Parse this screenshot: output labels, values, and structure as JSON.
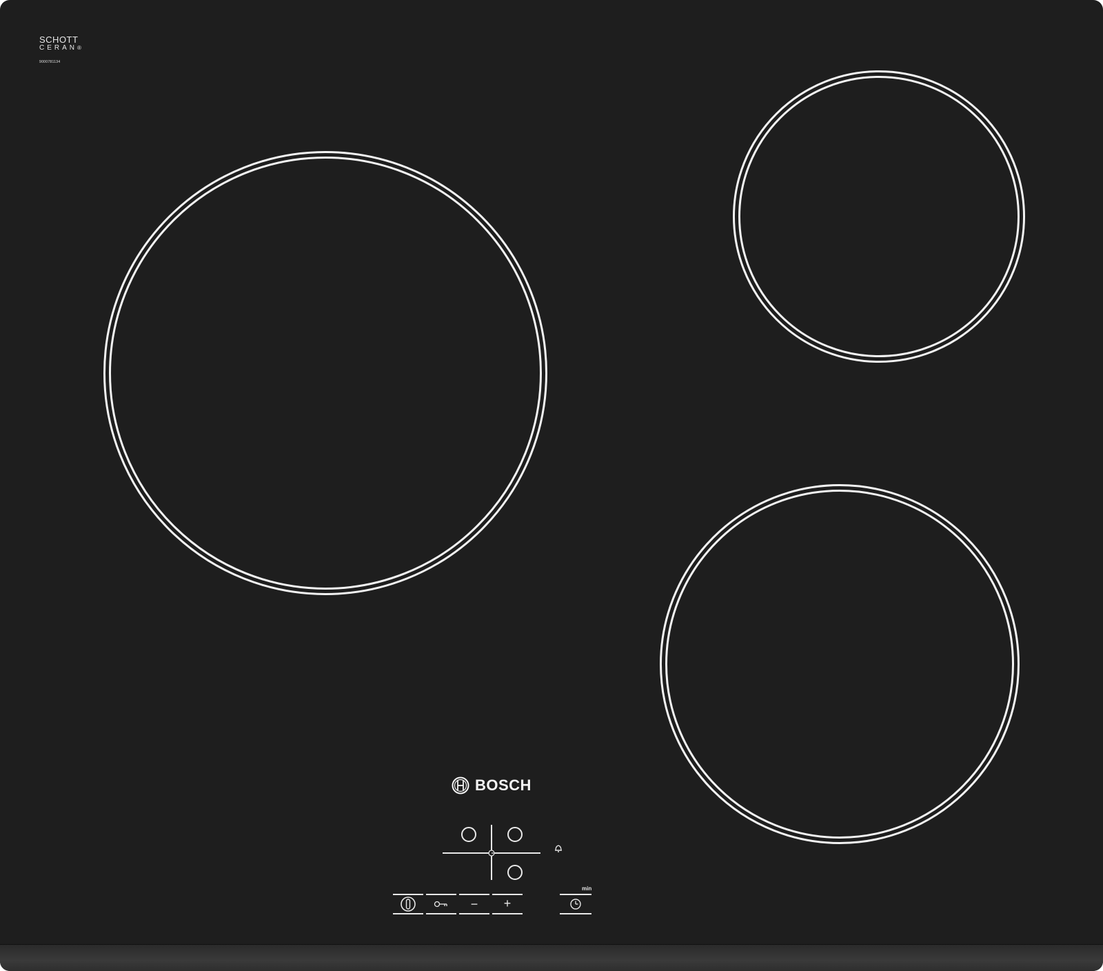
{
  "hob": {
    "zones": [
      {
        "name": "large-left"
      },
      {
        "name": "small-rear-right"
      },
      {
        "name": "medium-front-right"
      }
    ]
  },
  "schott": {
    "line1": "SCHOTT",
    "line2": "CERAN",
    "code": "9000781134"
  },
  "brand": {
    "name": "BOSCH"
  },
  "controls": {
    "minus_label": "−",
    "plus_label": "+",
    "min_label": "min"
  },
  "colors": {
    "glass": "#1e1e1e",
    "print": "#f2f2f2"
  }
}
